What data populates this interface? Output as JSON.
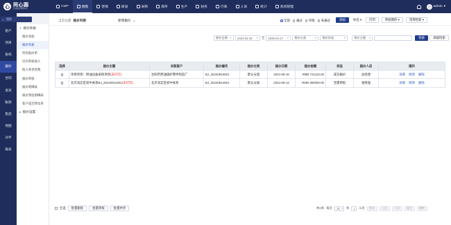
{
  "brand": {
    "logo_glyph": "心",
    "name": "同心圆",
    "subtitle": "企业综合管理平台",
    "color": "#1f2d5c"
  },
  "topnav": [
    {
      "label": "CMP",
      "active": false
    },
    {
      "label": "销售",
      "active": true
    },
    {
      "label": "营销",
      "active": false
    },
    {
      "label": "研发",
      "active": false
    },
    {
      "label": "采购",
      "active": false
    },
    {
      "label": "库存",
      "active": false
    },
    {
      "label": "生产",
      "active": false
    },
    {
      "label": "财务",
      "active": false
    },
    {
      "label": "行政",
      "active": false
    },
    {
      "label": "人资",
      "active": false
    },
    {
      "label": "统计",
      "active": false
    },
    {
      "label": "系统管理",
      "active": false
    }
  ],
  "user": {
    "name": "admin"
  },
  "sidebar": {
    "search_placeholder": "搜索",
    "items": [
      {
        "label": "客户",
        "active": false
      },
      {
        "label": "项目",
        "active": false
      },
      {
        "label": "投标",
        "active": false
      },
      {
        "label": "报价",
        "active": true
      },
      {
        "label": "合同",
        "active": false
      },
      {
        "label": "退货",
        "active": false
      },
      {
        "label": "账款",
        "active": false
      },
      {
        "label": "售后",
        "active": false
      },
      {
        "label": "地图",
        "active": false
      },
      {
        "label": "对手",
        "active": false
      },
      {
        "label": "报表",
        "active": false
      }
    ]
  },
  "subnav": {
    "group1": "报价单据",
    "items": [
      {
        "label": "报价添加",
        "active": false
      },
      {
        "label": "报价列表",
        "active": true
      },
      {
        "label": "所有报价单",
        "active": false
      },
      {
        "label": "另外审核他人",
        "active": false
      },
      {
        "label": "他人共享给我",
        "active": false
      },
      {
        "label": "报价审核",
        "active": false
      },
      {
        "label": "报价明细表",
        "active": false
      },
      {
        "label": "报价预估明细表",
        "active": false
      },
      {
        "label": "客户成交转化率",
        "active": false
      }
    ],
    "group2": "报价设置"
  },
  "crumb": {
    "label": "当前位置:",
    "current": "报价列表",
    "tab": "新增报价"
  },
  "radios": [
    {
      "label": "全部",
      "on": true
    },
    {
      "label": "通过",
      "on": false
    },
    {
      "label": "待批",
      "on": false
    },
    {
      "label": "未通过",
      "on": false
    }
  ],
  "top_buttons": {
    "add": "添加",
    "export": "导出",
    "print": "打印",
    "my_approval": "审核我的",
    "common_search": "常用检索"
  },
  "filters": {
    "date_type": "报价日期",
    "date_from": "2024-04-18",
    "date_to": "2025-04-17",
    "date_sep": "至",
    "category": "报价分类",
    "status": "报价状态",
    "keyword_field": "报价主题",
    "search_btn": "检索",
    "advanced_btn": "高级检索"
  },
  "table": {
    "headers": [
      "选择",
      "报价主题",
      "关联客户",
      "报价编号",
      "报价分类",
      "报价日期",
      "报价金额",
      "状态",
      "报价人员",
      "操作"
    ],
    "rows": [
      {
        "subject": "项目项目：燃油设备采购项目",
        "tag": "[未打印]",
        "customer": "沈阳市燃油锅炉零件制造厂",
        "code": "BJ_20240915001",
        "category": "默认分类",
        "date": "2024-09-15",
        "amount": "RMB 721120.00",
        "status": "成功报价",
        "staff": "总经理",
        "ops": [
          "详情",
          "修改",
          "删除"
        ]
      },
      {
        "subject": "北京海淀区初中关系BJ_20240914001",
        "tag": "[未打印]",
        "customer": "北京海淀区初中关系",
        "code": "BJ_20240914001",
        "category": "默认分类",
        "date": "2024-09-14",
        "amount": "RMB 360000.00",
        "status": "无需审批",
        "staff": "张晓强",
        "ops": [
          "详情",
          "修改",
          "删除"
        ]
      }
    ]
  },
  "bottom": {
    "select_all": "全选",
    "batch_delete": "批量删除",
    "batch_approve": "批量审核",
    "batch_share": "批量共享",
    "total": "共2条",
    "per_page_label": "每页",
    "per_page": "10",
    "per_page_unit": "条",
    "page": "1",
    "page_total": "/1页",
    "first": "首页",
    "prev": "上页",
    "next": "下页",
    "last": "尾页",
    "go": "跳转"
  }
}
